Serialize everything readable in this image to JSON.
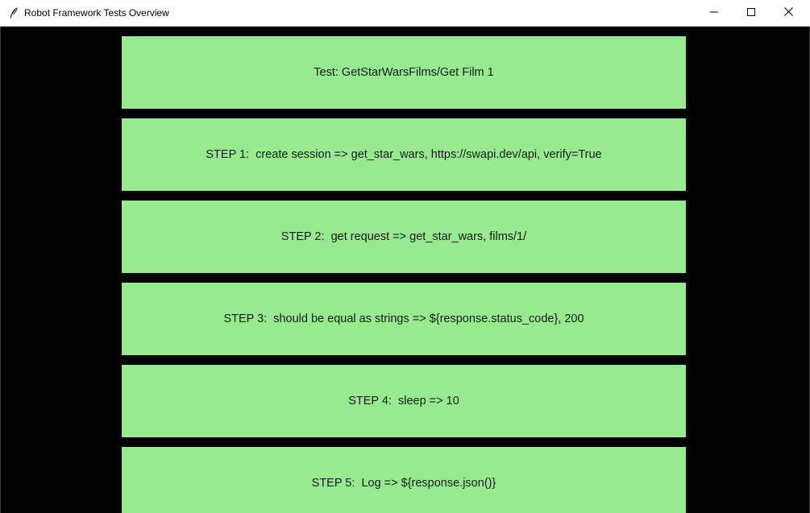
{
  "window": {
    "title": "Robot Framework Tests Overview",
    "icon": "feather-icon",
    "controls": {
      "minimize_icon": "minimize-icon",
      "maximize_icon": "maximize-icon",
      "close_icon": "close-icon"
    }
  },
  "colors": {
    "panel_background": "#96eb91",
    "window_background": "#000000",
    "titlebar_background": "#ffffff"
  },
  "panels": [
    {
      "text": "Test: GetStarWarsFilms/Get Film 1"
    },
    {
      "text": "STEP 1:  create session => get_star_wars, https://swapi.dev/api, verify=True"
    },
    {
      "text": "STEP 2:  get request => get_star_wars, films/1/"
    },
    {
      "text": "STEP 3:  should be equal as strings => ${response.status_code}, 200"
    },
    {
      "text": "STEP 4:  sleep => 10"
    },
    {
      "text": "STEP 5:  Log => ${response.json()}"
    }
  ]
}
